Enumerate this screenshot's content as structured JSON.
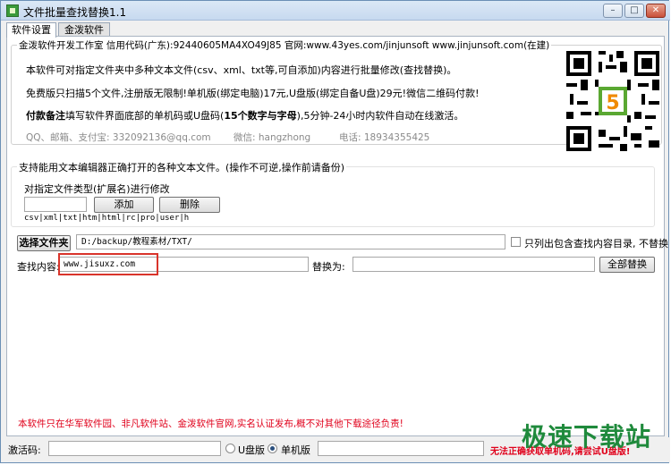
{
  "window": {
    "title": "文件批量查找替换1.1"
  },
  "tabs": [
    {
      "label": "软件设置"
    },
    {
      "label": "金泼软件"
    }
  ],
  "info": {
    "group_title": "金泼软件开发工作室 信用代码(广东):92440605MA4XO49J85 官网:www.43yes.com/jinjunsoft  www.jinjunsoft.com(在建)",
    "line1": "本软件可对指定文件夹中多种文本文件(csv、xml、txt等,可自添加)内容进行批量修改(查找替换)。",
    "line2": "免费版只扫描5个文件,注册版无限制!单机版(绑定电脑)17元,U盘版(绑定自备U盘)29元!微信二维码付款!",
    "line3_bold": "付款备注",
    "line3_rest": "填写软件界面底部的单机码或U盘码(",
    "line3_bold2": "15个数字与字母",
    "line3_end": "),5分钟-24小时内软件自动在线激活。",
    "contact_qq": "QQ、邮箱、支付宝: 332092136@qq.com",
    "contact_wechat": "微信: hangzhong",
    "contact_phone": "电话: 18934355425"
  },
  "filetypes": {
    "group_title": "支持能用文本编辑器正确打开的各种文本文件。(操作不可逆,操作前请备份)",
    "label": "对指定文件类型(扩展名)进行修改",
    "input_value": "",
    "add_label": "添加",
    "delete_label": "删除",
    "list": "csv|xml|txt|htm|html|rc|pro|user|h"
  },
  "folder": {
    "button_label": "选择文件夹",
    "path": "D:/backup/教程素材/TXT/",
    "only_list_label": "只列出包含查找内容目录, 不替换",
    "only_list_checked": false
  },
  "replace": {
    "find_label": "查找内容:",
    "find_value": "www.jisuxz.com",
    "replace_label": "替换为:",
    "replace_value": "",
    "replace_all_label": "全部替换"
  },
  "footer": {
    "notice": "本软件只在华军软件园、非凡软件站、金泼软件官网,实名认证发布,概不对其他下载途径负责!"
  },
  "status": {
    "activation_label": "激活码:",
    "activation_value": "",
    "usb_label": "U盘版",
    "single_label": "单机版",
    "mode_selected": "单机版",
    "machine_code": "",
    "warning": "无法正确获取单机码,请尝试U盘版!"
  },
  "watermark": "极速下载站",
  "colors": {
    "accent_red": "#e0001b",
    "highlight_box": "#d9342b",
    "watermark_green": "#1f8a3c"
  }
}
